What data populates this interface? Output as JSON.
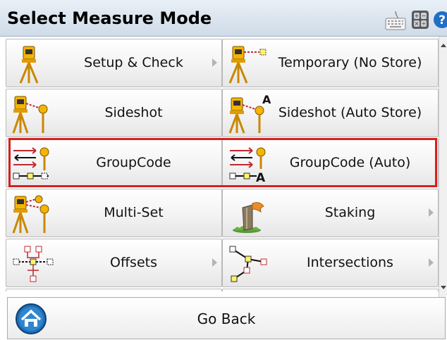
{
  "title": "Select Measure Mode",
  "toolbar_icons": [
    "keyboard-icon",
    "calculator-icon",
    "help-icon"
  ],
  "items": [
    {
      "label": "Setup & Check",
      "icon": "tripod-icon",
      "submenu": true
    },
    {
      "label": "Temporary (No Store)",
      "icon": "tripod-temporary-icon",
      "submenu": false
    },
    {
      "label": "Sideshot",
      "icon": "tripod-prism-icon",
      "submenu": false
    },
    {
      "label": "Sideshot (Auto Store)",
      "icon": "tripod-prism-auto-icon",
      "submenu": false
    },
    {
      "label": "GroupCode",
      "icon": "groupcode-icon",
      "submenu": false
    },
    {
      "label": "GroupCode (Auto)",
      "icon": "groupcode-auto-icon",
      "submenu": false
    },
    {
      "label": "Multi-Set",
      "icon": "multiset-icon",
      "submenu": false
    },
    {
      "label": "Staking",
      "icon": "stake-icon",
      "submenu": true
    },
    {
      "label": "Offsets",
      "icon": "offsets-icon",
      "submenu": true
    },
    {
      "label": "Intersections",
      "icon": "intersections-icon",
      "submenu": true
    }
  ],
  "go_back_label": "Go Back",
  "colors": {
    "highlight": "#d81e1e",
    "title_bar": "#dbe5f0",
    "accent_red": "#c0282f",
    "accent_gold": "#e8a41b"
  }
}
